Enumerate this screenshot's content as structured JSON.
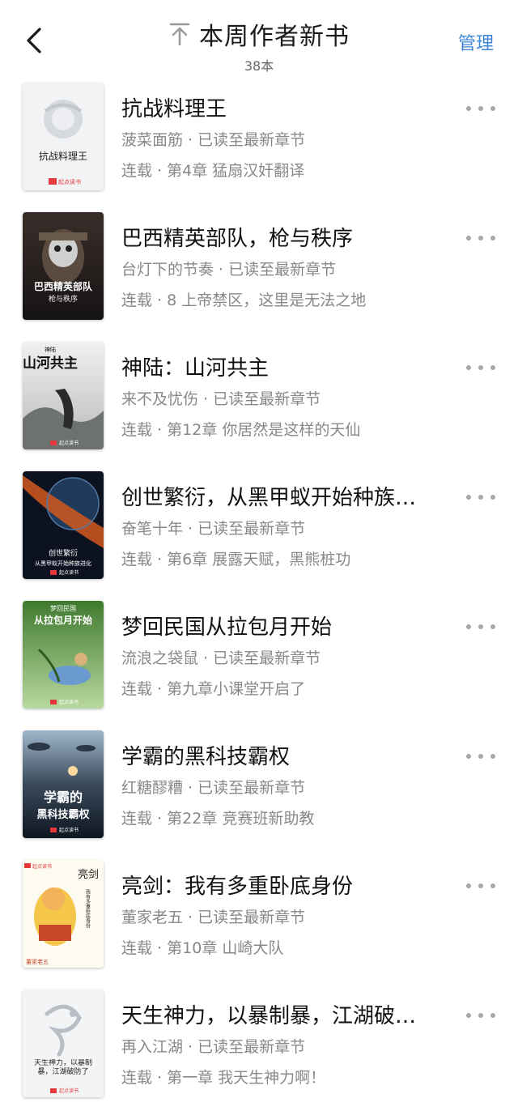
{
  "header": {
    "title": "本周作者新书",
    "count": "38本",
    "manage_label": "管理"
  },
  "books": [
    {
      "title": "抗战料理王",
      "author": "菠菜面筋",
      "status": "已读至最新章节",
      "serial": "连载",
      "chapter": "第4章 猛扇汉奸翻译",
      "cover_title": "抗战料理王",
      "cover_brand": "起点读书"
    },
    {
      "title": "巴西精英部队，枪与秩序",
      "author": "台灯下的节奏",
      "status": "已读至最新章节",
      "serial": "连载",
      "chapter": "8 上帝禁区，这里是无法之地",
      "cover_title": "巴西精英部队",
      "cover_sub": "枪与秩序"
    },
    {
      "title": "神陆：山河共主",
      "author": "来不及忧伤",
      "status": "已读至最新章节",
      "serial": "连载",
      "chapter": "第12章 你居然是这样的天仙",
      "cover_title": "山河共主",
      "cover_sub": "神陆",
      "cover_brand": "起点读书"
    },
    {
      "title": "创世繁衍，从黑甲蚁开始种族…",
      "author": "奋笔十年",
      "status": "已读至最新章节",
      "serial": "连载",
      "chapter": "第6章 展露天赋，黑熊桩功",
      "cover_title": "创世繁衍",
      "cover_sub": "从黑甲蚁开始种族进化",
      "cover_brand": "起点读书"
    },
    {
      "title": "梦回民国从拉包月开始",
      "author": "流浪之袋鼠",
      "status": "已读至最新章节",
      "serial": "连载",
      "chapter": "第九章小课堂开启了",
      "cover_title": "从拉包月开始",
      "cover_sub": "梦回民国",
      "cover_brand": "起点读书"
    },
    {
      "title": "学霸的黑科技霸权",
      "author": "红糖醪糟",
      "status": "已读至最新章节",
      "serial": "连载",
      "chapter": "第22章 竞赛班新助教",
      "cover_title": "学霸的",
      "cover_sub": "黑科技霸权",
      "cover_brand": "起点读书"
    },
    {
      "title": "亮剑：我有多重卧底身份",
      "author": "董家老五",
      "status": "已读至最新章节",
      "serial": "连载",
      "chapter": "第10章 山崎大队",
      "cover_title": "亮剑",
      "cover_sub": "我有多重卧底身份",
      "cover_brand": "起点读书",
      "cover_author": "董家老五"
    },
    {
      "title": "天生神力，以暴制暴，江湖破…",
      "author": "再入江湖",
      "status": "已读至最新章节",
      "serial": "连载",
      "chapter": "第一章 我天生神力啊！",
      "cover_title": "天生神力，以暴制暴，江湖破防了",
      "cover_brand": "起点读书"
    }
  ],
  "colors": {
    "accent": "#3d86d9",
    "meta_text": "#888888",
    "brand_red": "#e4393c"
  }
}
